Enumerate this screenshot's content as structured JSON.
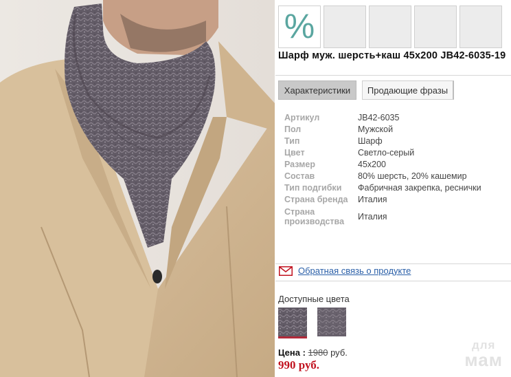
{
  "product": {
    "title": "Шарф муж. шерсть+каш 45х200 JB42-6035-19"
  },
  "gallery": {
    "thumbnails": [
      {
        "label": "%",
        "kind": "discount-badge"
      },
      {
        "label": "",
        "kind": "image"
      },
      {
        "label": "",
        "kind": "image"
      },
      {
        "label": "",
        "kind": "image"
      },
      {
        "label": "",
        "kind": "image"
      }
    ]
  },
  "tabs": [
    {
      "label": "Характеристики",
      "active": true
    },
    {
      "label": "Продающие фразы",
      "active": false
    }
  ],
  "specs": [
    {
      "key": "Артикул",
      "value": "JB42-6035"
    },
    {
      "key": "Пол",
      "value": "Мужской"
    },
    {
      "key": "Тип",
      "value": "Шарф"
    },
    {
      "key": "Цвет",
      "value": "Светло-серый"
    },
    {
      "key": "Размер",
      "value": "45х200"
    },
    {
      "key": "Состав",
      "value": "80% шерсть, 20% кашемир"
    },
    {
      "key": "Тип подгибки",
      "value": "Фабричная закрепка, реснички"
    },
    {
      "key": "Страна бренда",
      "value": "Италия"
    },
    {
      "key": "Страна производства",
      "value": "Италия"
    }
  ],
  "feedback": {
    "link_text": "Обратная связь о продукте",
    "icon": "envelope-icon"
  },
  "colors": {
    "label": "Доступные цвета",
    "swatches": [
      {
        "name": "gray-melange",
        "color": "#6e6670",
        "selected": true
      },
      {
        "name": "gray-pattern",
        "color": "#7a737c",
        "selected": false
      }
    ]
  },
  "price": {
    "label": "Цена :",
    "old_value": "1980",
    "old_currency": "руб.",
    "new_value": "990 руб."
  },
  "watermark": {
    "line1": "для",
    "line2": "мам"
  },
  "theme": {
    "accent_red": "#c1121f",
    "link_blue": "#2a5fa8",
    "discount_teal": "#5aa6a0"
  }
}
